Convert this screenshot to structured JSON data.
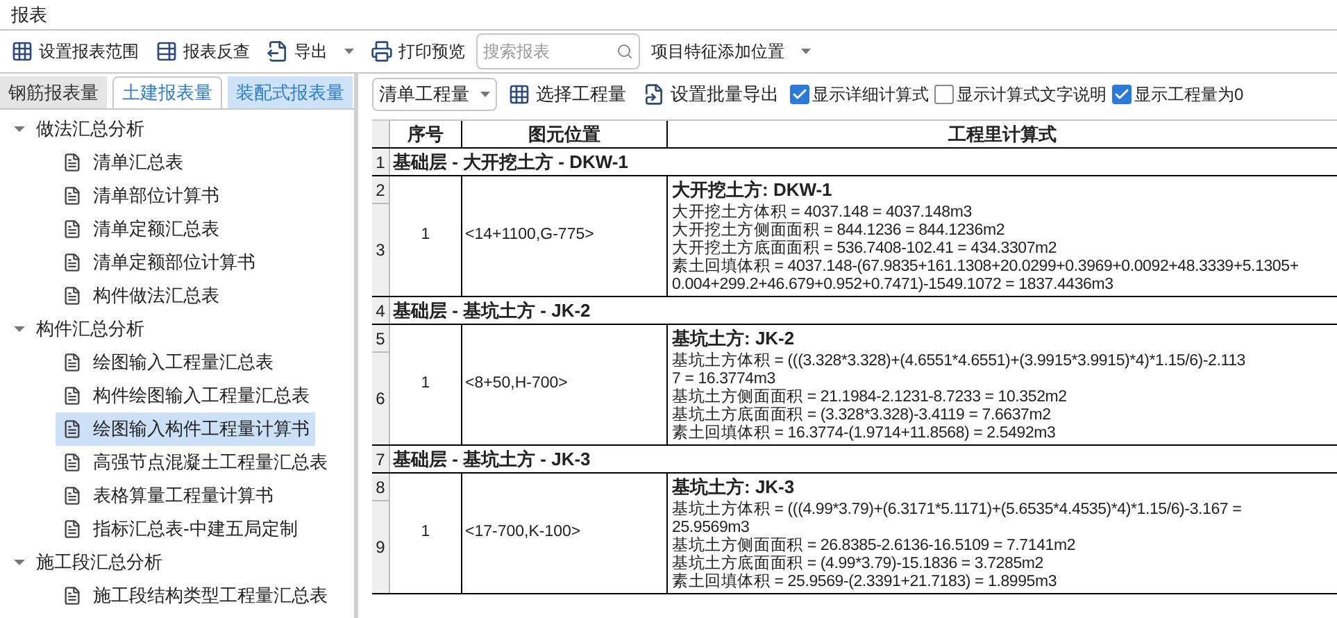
{
  "window": {
    "title": "报表"
  },
  "toolbar": {
    "buttons": [
      {
        "kind": "range",
        "label": "设置报表范围",
        "dropdown": false
      },
      {
        "kind": "lookup",
        "label": "报表反查",
        "dropdown": false
      },
      {
        "kind": "export",
        "label": "导出",
        "dropdown": true
      },
      {
        "kind": "print",
        "label": "打印预览",
        "dropdown": false
      }
    ],
    "search": {
      "placeholder": "搜索报表"
    },
    "position_select": {
      "value": "项目特征添加位置"
    }
  },
  "tabs": [
    {
      "label": "钢筋报表量",
      "selected": false,
      "highlighted": false
    },
    {
      "label": "土建报表量",
      "selected": true,
      "highlighted": false
    },
    {
      "label": "装配式报表量",
      "selected": false,
      "highlighted": true
    }
  ],
  "tree": [
    {
      "label": "做法汇总分析",
      "expanded": true,
      "children": [
        {
          "label": "清单汇总表",
          "selected": false
        },
        {
          "label": "清单部位计算书",
          "selected": false
        },
        {
          "label": "清单定额汇总表",
          "selected": false
        },
        {
          "label": "清单定额部位计算书",
          "selected": false
        },
        {
          "label": "构件做法汇总表",
          "selected": false
        }
      ]
    },
    {
      "label": "构件汇总分析",
      "expanded": true,
      "children": [
        {
          "label": "绘图输入工程量汇总表",
          "selected": false
        },
        {
          "label": "构件绘图输入工程量汇总表",
          "selected": false
        },
        {
          "label": "绘图输入构件工程量计算书",
          "selected": true
        },
        {
          "label": "高强节点混凝土工程量汇总表",
          "selected": false
        },
        {
          "label": "表格算量工程量计算书",
          "selected": false
        },
        {
          "label": "指标汇总表-中建五局定制",
          "selected": false
        }
      ]
    },
    {
      "label": "施工段汇总分析",
      "expanded": true,
      "children": [
        {
          "label": "施工段结构类型工程量汇总表",
          "selected": false
        }
      ]
    }
  ],
  "report_toolbar": {
    "quantity_select": {
      "value": "清单工程量"
    },
    "buttons": [
      {
        "kind": "select",
        "label": "选择工程量"
      },
      {
        "kind": "batch",
        "label": "设置批量导出"
      }
    ],
    "checkboxes": [
      {
        "label": "显示详细计算式",
        "checked": true
      },
      {
        "label": "显示计算式文字说明",
        "checked": false
      },
      {
        "label": "显示工程量为0",
        "checked": true
      }
    ]
  },
  "table": {
    "columns": [
      "序号",
      "图元位置",
      "工程里计算式"
    ],
    "groups": [
      {
        "row": "1",
        "header": "基础层 - 大开挖土方 - DKW-1",
        "rows": [
          "2",
          "3"
        ],
        "seq": "1",
        "location": "<14+1100,G-775>",
        "title": "大开挖土方: DKW-1",
        "lines": [
          "大开挖土方体积 = 4037.148 = 4037.148m3",
          "大开挖土方侧面面积 = 844.1236 = 844.1236m2",
          "大开挖土方底面面积 = 536.7408-102.41 = 434.3307m2",
          "素土回填体积 = 4037.148-(67.9835+161.1308+20.0299+0.3969+0.0092+48.3339+5.1305+",
          "0.004+299.2+46.679+0.952+0.7471)-1549.1072 = 1837.4436m3"
        ]
      },
      {
        "row": "4",
        "header": "基础层 - 基坑土方 - JK-2",
        "rows": [
          "5",
          "6"
        ],
        "seq": "1",
        "location": "<8+50,H-700>",
        "title": "基坑土方: JK-2",
        "lines": [
          "基坑土方体积 = (((3.328*3.328)+(4.6551*4.6551)+(3.9915*3.9915)*4)*1.15/6)-2.113",
          "7 = 16.3774m3",
          "基坑土方侧面面积 = 21.1984-2.1231-8.7233 = 10.352m2",
          "基坑土方底面面积 = (3.328*3.328)-3.4119 = 7.6637m2",
          "素土回填体积 = 16.3774-(1.9714+11.8568) = 2.5492m3"
        ]
      },
      {
        "row": "7",
        "header": "基础层 - 基坑土方 - JK-3",
        "rows": [
          "8",
          "9"
        ],
        "seq": "1",
        "location": "<17-700,K-100>",
        "title": "基坑土方: JK-3",
        "lines": [
          "基坑土方体积 = (((4.99*3.79)+(6.3171*5.1171)+(5.6535*4.4535)*4)*1.15/6)-3.167 =",
          "25.9569m3",
          "基坑土方侧面面积 = 26.8385-2.6136-16.5109 = 7.7141m2",
          "基坑土方底面面积 = (4.99*3.79)-15.1836 = 3.7285m2",
          "素土回填体积 = 25.9569-(2.3391+21.7183) = 1.8995m3"
        ]
      }
    ]
  }
}
